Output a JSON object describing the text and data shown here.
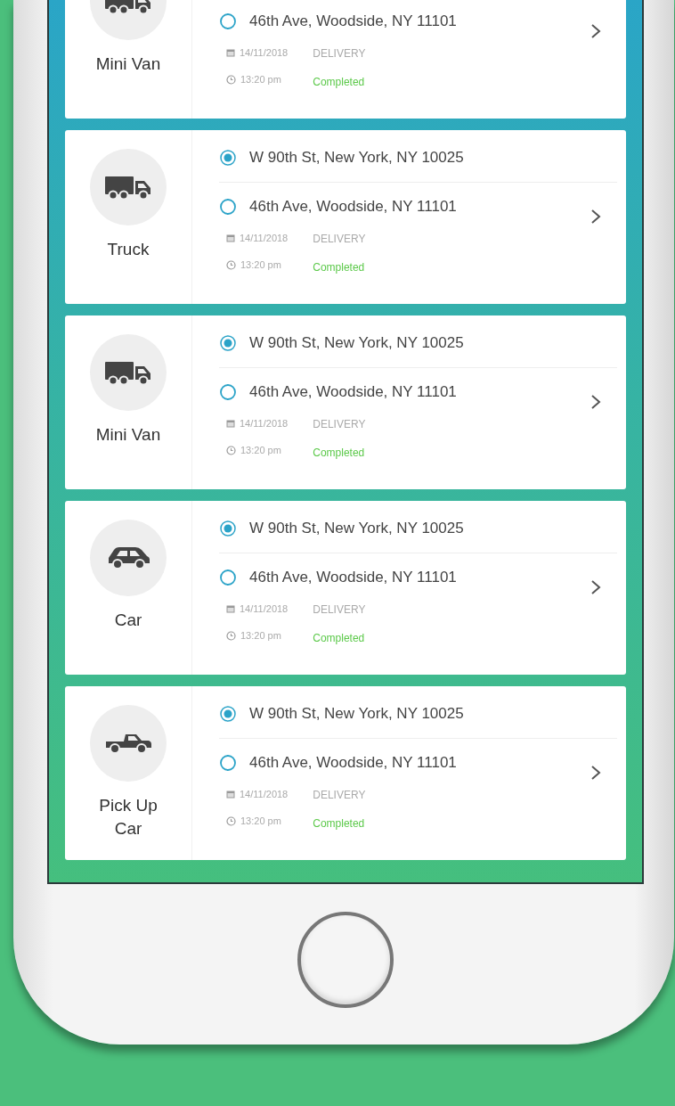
{
  "trips": [
    {
      "kind": "truck",
      "vehicle": "Mini Van",
      "to": "46th Ave, Woodside, NY 11101",
      "date": "14/11/2018",
      "type": "DELIVERY",
      "time": "13:20 pm",
      "status": "Completed"
    },
    {
      "kind": "truck",
      "vehicle": "Truck",
      "from": "W 90th St, New York, NY 10025",
      "to": "46th Ave, Woodside, NY 11101",
      "date": "14/11/2018",
      "type": "DELIVERY",
      "time": "13:20 pm",
      "status": "Completed"
    },
    {
      "kind": "truck",
      "vehicle": "Mini Van",
      "from": "W 90th St, New York, NY 10025",
      "to": "46th Ave, Woodside, NY 11101",
      "date": "14/11/2018",
      "type": "DELIVERY",
      "time": "13:20 pm",
      "status": "Completed"
    },
    {
      "kind": "car",
      "vehicle": "Car",
      "from": "W 90th St, New York, NY 10025",
      "to": "46th Ave, Woodside, NY 11101",
      "date": "14/11/2018",
      "type": "DELIVERY",
      "time": "13:20 pm",
      "status": "Completed"
    },
    {
      "kind": "pickup",
      "vehicle": "Pick Up Car",
      "from": "W 90th St, New York, NY 10025",
      "to": "46th Ave, Woodside, NY 11101",
      "date": "14/11/2018",
      "type": "DELIVERY",
      "time": "13:20 pm",
      "status": "Completed"
    }
  ]
}
